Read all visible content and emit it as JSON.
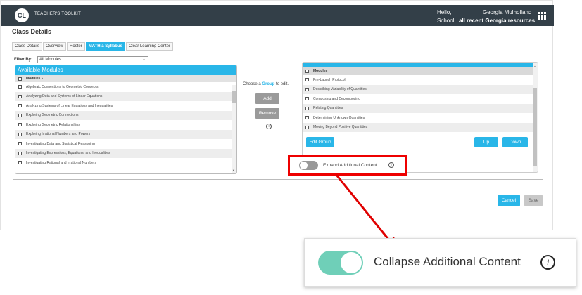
{
  "header": {
    "logo_text": "CL",
    "brand": "TEACHER'S TOOLKIT",
    "hello": "Hello,",
    "user_name": "Georgia Mulholland",
    "school_label": "School:",
    "school_value": "all recent Georgia resources",
    "apps_icon": "grid-icon"
  },
  "page": {
    "title": "Class Details",
    "tabs": [
      {
        "label": "Class Details",
        "active": false
      },
      {
        "label": "Overview",
        "active": false
      },
      {
        "label": "Roster",
        "active": false
      },
      {
        "label": "MATHia Syllabus",
        "active": true
      },
      {
        "label": "Clear Learning Center",
        "active": false
      }
    ],
    "filter_label": "Filter By:",
    "filter_value": "All Modules"
  },
  "available": {
    "title": "Available Modules",
    "column": "Modules ▴",
    "items": [
      "Algebraic Connections to Geometric Concepts",
      "Analyzing Data and Systems of Linear Equations",
      "Analyzing Systems of Linear Equations and Inequalities",
      "Exploring Geometric Connections",
      "Exploring Geometric Relationships",
      "Exploring Irrational Numbers and Powers",
      "Investigating Data and Statistical Reasoning",
      "Investigating Expressions, Equations, and Inequalities",
      "Investigating Rational and Irrational Numbers"
    ]
  },
  "middle": {
    "choose_prefix": "Choose a",
    "choose_group": "Group",
    "choose_suffix": "to edit.",
    "add_label": "Add",
    "remove_label": "Remove",
    "info_glyph": "i"
  },
  "group": {
    "column": "Modules",
    "items": [
      "Pre-Launch Protocol",
      "Describing Variability of Quantities",
      "Composing and Decomposing",
      "Relating Quantities",
      "Determining Unknown Quantities",
      "Moving Beyond Positive Quantities"
    ],
    "edit_label": "Edit Group",
    "up_label": "Up",
    "down_label": "Down"
  },
  "expand": {
    "label": "Expand Additional Content",
    "info_glyph": "i",
    "toggled": false
  },
  "actions": {
    "cancel_label": "Cancel",
    "save_label": "Save"
  },
  "zoom": {
    "label": "Collapse Additional Content",
    "info_glyph": "i",
    "toggled": true
  },
  "colors": {
    "accent": "#29b6e8",
    "topbar": "#333f48",
    "highlight": "#e00000",
    "toggle_on": "#6fcfb8"
  }
}
